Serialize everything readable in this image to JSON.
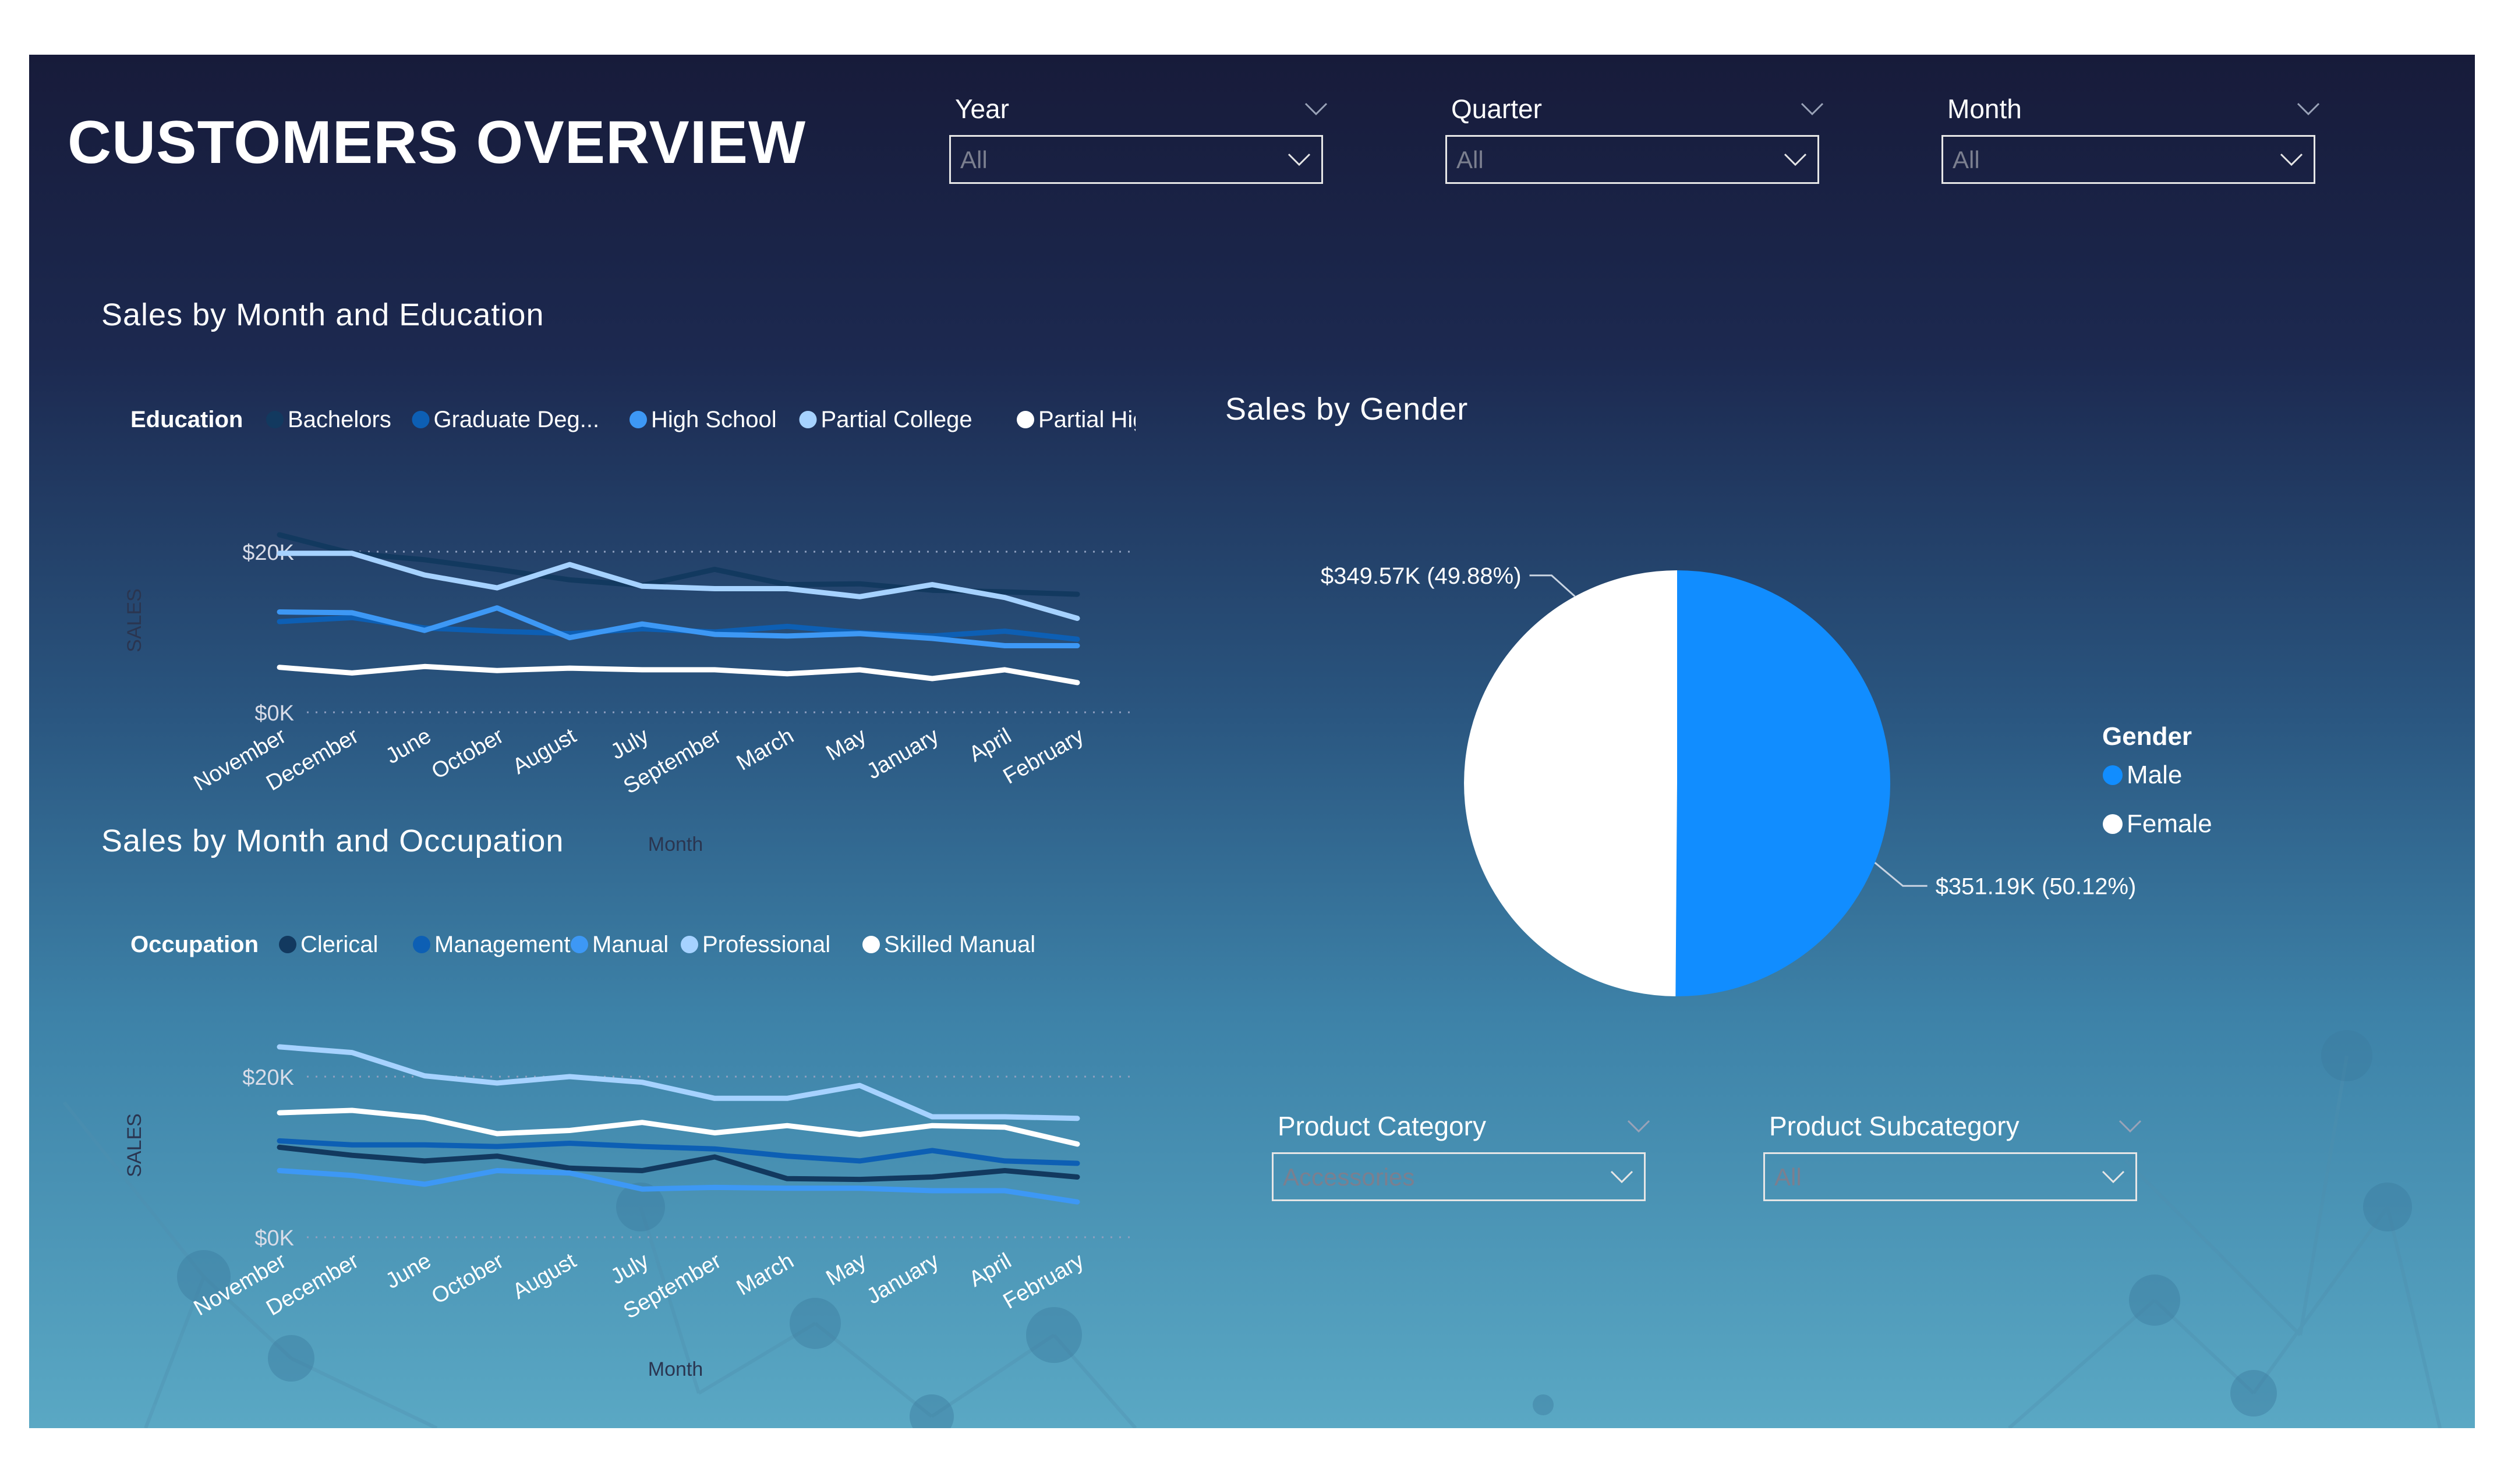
{
  "page": {
    "title": "CUSTOMERS OVERVIEW"
  },
  "slicers": {
    "year": {
      "label": "Year",
      "value": "All"
    },
    "quarter": {
      "label": "Quarter",
      "value": "All"
    },
    "month": {
      "label": "Month",
      "value": "All"
    },
    "product_category": {
      "label": "Product Category",
      "value": "Accessories"
    },
    "product_subcategory": {
      "label": "Product Subcategory",
      "value": "All"
    }
  },
  "colors": {
    "bachelors": "#12395f",
    "graduate": "#0d5fb4",
    "high_school": "#3d98f5",
    "partial_college": "#a6d2ff",
    "partial_high": "#ffffff",
    "male": "#118dff",
    "female": "#ffffff"
  },
  "chart_data": [
    {
      "type": "line",
      "title": "Sales by Month and Education",
      "legend_title": "Education",
      "legend_placement": "top",
      "xlabel": "Month",
      "ylabel": "SALES",
      "ylim": [
        0,
        20000
      ],
      "yticks": [
        "$0K",
        "$20K"
      ],
      "grid": true,
      "categories": [
        "November",
        "December",
        "June",
        "October",
        "August",
        "July",
        "September",
        "March",
        "May",
        "January",
        "April",
        "February"
      ],
      "series": [
        {
          "name": "Bachelors",
          "values": [
            22100,
            19800,
            19000,
            17800,
            16500,
            15800,
            17800,
            15900,
            16000,
            15200,
            15000,
            14700
          ]
        },
        {
          "name": "Graduate Deg...",
          "values": [
            11300,
            11800,
            10500,
            10100,
            9800,
            10400,
            10000,
            10700,
            9900,
            9500,
            10100,
            9100
          ]
        },
        {
          "name": "High School",
          "values": [
            12500,
            12400,
            10200,
            13000,
            9300,
            11000,
            9700,
            9500,
            9800,
            9200,
            8300,
            8300
          ]
        },
        {
          "name": "Partial College",
          "values": [
            19800,
            19800,
            17100,
            15500,
            18400,
            15700,
            15400,
            15400,
            14400,
            15900,
            14300,
            11700
          ]
        },
        {
          "name": "Partial High S...",
          "values": [
            5600,
            4900,
            5700,
            5200,
            5500,
            5300,
            5300,
            4800,
            5300,
            4200,
            5300,
            3700
          ]
        }
      ]
    },
    {
      "type": "line",
      "title": "Sales by Month and Occupation",
      "legend_title": "Occupation",
      "legend_placement": "top",
      "xlabel": "Month",
      "ylabel": "SALES",
      "ylim": [
        0,
        20000
      ],
      "yticks": [
        "$0K",
        "$20K"
      ],
      "grid": true,
      "categories": [
        "November",
        "December",
        "June",
        "October",
        "August",
        "July",
        "September",
        "March",
        "May",
        "January",
        "April",
        "February"
      ],
      "series": [
        {
          "name": "Clerical",
          "values": [
            11200,
            10200,
            9500,
            10100,
            8600,
            8300,
            10000,
            7300,
            7200,
            7500,
            8300,
            7500
          ]
        },
        {
          "name": "Management",
          "values": [
            12000,
            11500,
            11500,
            11300,
            11700,
            11300,
            11000,
            10100,
            9500,
            10800,
            9500,
            9200
          ]
        },
        {
          "name": "Manual",
          "values": [
            8300,
            7700,
            6600,
            8300,
            8000,
            6000,
            6200,
            6100,
            6100,
            5800,
            5800,
            4400
          ]
        },
        {
          "name": "Professional",
          "values": [
            23700,
            23000,
            20100,
            19200,
            20000,
            19300,
            17300,
            17300,
            18900,
            15000,
            15000,
            14800
          ]
        },
        {
          "name": "Skilled Manual",
          "values": [
            15500,
            15800,
            14900,
            12900,
            13300,
            14300,
            13000,
            13900,
            12800,
            13900,
            13700,
            11600
          ]
        }
      ]
    },
    {
      "type": "pie",
      "title": "Sales by Gender",
      "legend_title": "Gender",
      "legend_placement": "right",
      "slices": [
        {
          "name": "Male",
          "value": 351190,
          "percent": 50.12,
          "label": "$351.19K (50.12%)"
        },
        {
          "name": "Female",
          "value": 349570,
          "percent": 49.88,
          "label": "$349.57K (49.88%)"
        }
      ]
    }
  ]
}
